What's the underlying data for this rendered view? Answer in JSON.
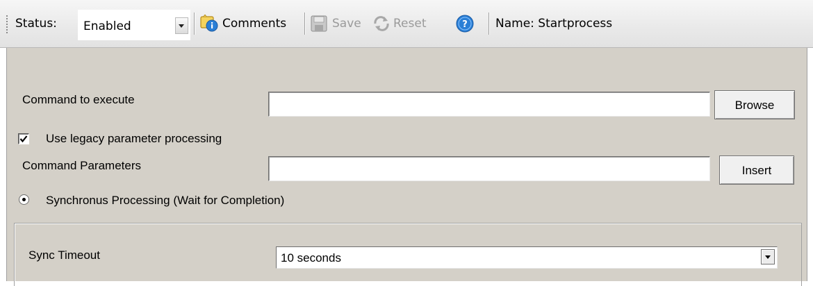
{
  "toolbar": {
    "status_label": "Status:",
    "status_value": "Enabled",
    "comments_label": "Comments",
    "save_label": "Save",
    "reset_label": "Reset",
    "name_text": "Name: Startprocess"
  },
  "form": {
    "command_label": "Command to execute",
    "command_value": "",
    "browse_label": "Browse",
    "legacy_checkbox_label": "Use legacy parameter processing",
    "legacy_checked": true,
    "params_label": "Command Parameters",
    "params_value": "",
    "insert_label": "Insert",
    "sync_radio_label": "Synchronus Processing (Wait for Completion)",
    "sync_selected": true,
    "sync_timeout_label": "Sync Timeout",
    "sync_timeout_value": "10 seconds"
  },
  "icons": {
    "comments": "comments-icon",
    "save": "save-icon",
    "reset": "reset-icon",
    "help": "help-icon"
  },
  "colors": {
    "panel_bg": "#d4d0c8",
    "toolbar_bg": "#ececec",
    "disabled_text": "#9a9a9a",
    "help_blue": "#2a7fd6"
  }
}
